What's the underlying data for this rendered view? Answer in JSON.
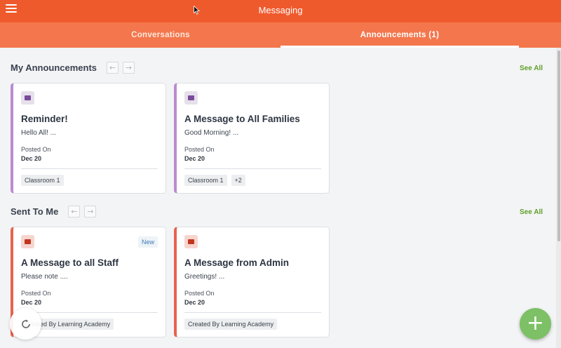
{
  "header": {
    "title": "Messaging",
    "menu_icon": "hamburger-menu-icon"
  },
  "tabs": [
    {
      "label": "Conversations",
      "active": false
    },
    {
      "label": "Announcements (1)",
      "active": true
    }
  ],
  "my_announcements": {
    "title": "My Announcements",
    "see_all": "See All",
    "prev_icon": "←",
    "next_icon": "→",
    "cards": [
      {
        "icon": "pin-icon",
        "title": "Reminder!",
        "preview": "Hello All! ...",
        "posted_label": "Posted On",
        "posted_date": "Dec 20",
        "tags": [
          "Classroom 1"
        ]
      },
      {
        "icon": "pin-icon",
        "title": "A Message to All Families",
        "preview": "Good Morning! ...",
        "posted_label": "Posted On",
        "posted_date": "Dec 20",
        "tags": [
          "Classroom 1",
          "+2"
        ]
      }
    ]
  },
  "sent_to_me": {
    "title": "Sent To Me",
    "see_all": "See All",
    "prev_icon": "←",
    "next_icon": "→",
    "cards": [
      {
        "icon": "briefcase-icon",
        "badge": "New",
        "title": "A Message to all Staff",
        "preview": "Please note ....",
        "posted_label": "Posted On",
        "posted_date": "Dec 20",
        "tags": [
          "Created By Learning Academy"
        ]
      },
      {
        "icon": "briefcase-icon",
        "title": "A Message from Admin",
        "preview": "Greetings! ...",
        "posted_label": "Posted On",
        "posted_date": "Dec 20",
        "tags": [
          "Created By Learning Academy"
        ]
      }
    ]
  },
  "fab": {
    "label": "+",
    "icon": "plus-icon"
  },
  "refresh": {
    "icon": "refresh-icon"
  },
  "colors": {
    "header": "#ef5a2d",
    "tabbar": "#f4764c",
    "accent_green": "#5f9e2a",
    "fab": "#7dc066",
    "announcement_border": "#b98bd1",
    "received_border": "#e8624e"
  }
}
